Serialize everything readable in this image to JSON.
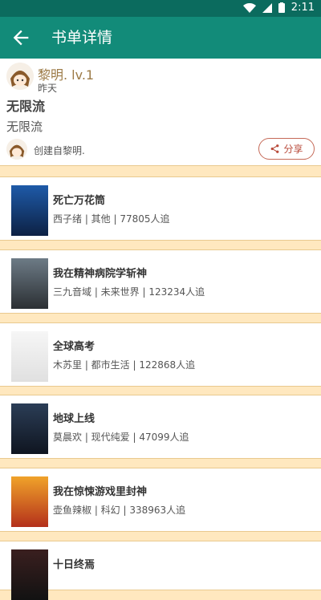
{
  "status": {
    "time": "2:11"
  },
  "header": {
    "title": "书单详情"
  },
  "author": {
    "name": "黎明.  lv.1",
    "time": "昨天"
  },
  "booklist": {
    "title": "无限流",
    "description": "无限流",
    "created_by": "创建自黎明.",
    "share_label": "分享"
  },
  "books": [
    {
      "name": "死亡万花筒",
      "meta": "西子绪  |  其他  |  77805人追"
    },
    {
      "name": "我在精神病院学斩神",
      "meta": "三九音域  |  未来世界  |  123234人追"
    },
    {
      "name": "全球高考",
      "meta": "木苏里  |  都市生活  |  122868人追"
    },
    {
      "name": "地球上线",
      "meta": "莫晨欢  |  现代纯爱  |  47099人追"
    },
    {
      "name": "我在惊悚游戏里封神",
      "meta": "壶鱼辣椒  |  科幻  |  338963人追"
    },
    {
      "name": "十日终焉",
      "meta": ""
    }
  ],
  "colors": {
    "status_bar": "#0b6b5e",
    "app_bar": "#128b79",
    "background": "#ffe8bf",
    "author_name": "#9c7a46",
    "share": "#b84a3a"
  }
}
